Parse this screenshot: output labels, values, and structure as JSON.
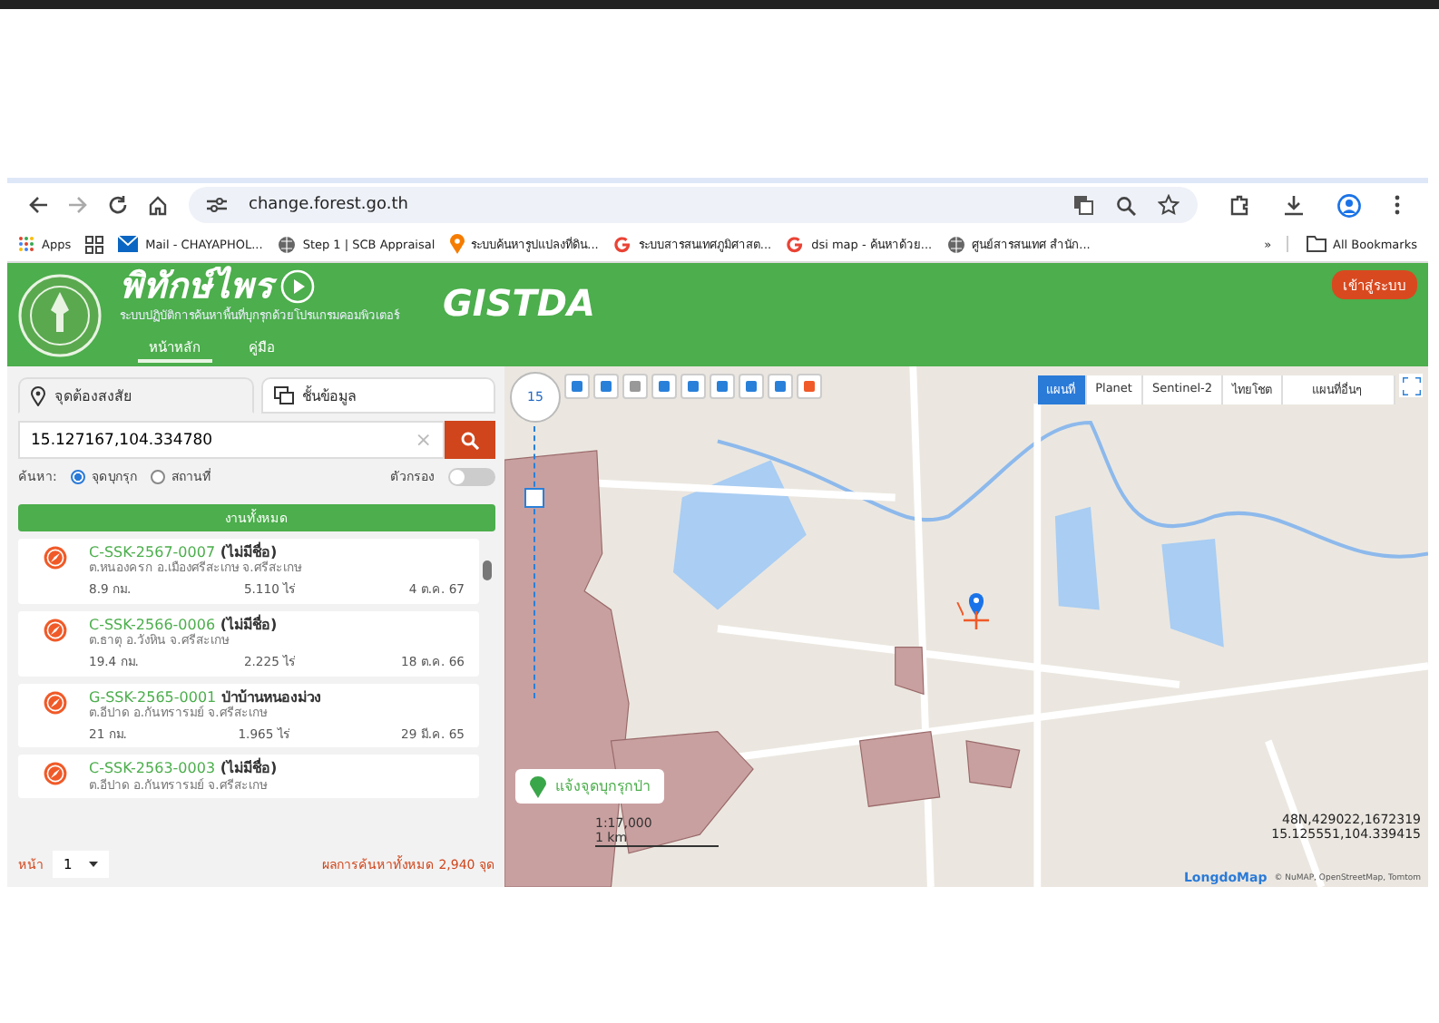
{
  "browser": {
    "url": "change.forest.go.th",
    "bookmarks": [
      {
        "label": "Apps",
        "kind": "apps"
      },
      {
        "kind": "grid"
      },
      {
        "label": "Mail - CHAYAPHOL...",
        "kind": "mail"
      },
      {
        "label": "Step 1 | SCB Appraisal",
        "kind": "globe"
      },
      {
        "label": "ระบบค้นหารูปแปลงที่ดิน...",
        "kind": "pin"
      },
      {
        "label": "ระบบสารสนเทศภูมิศาสต...",
        "kind": "google"
      },
      {
        "label": "dsi map - ค้นหาด้วย...",
        "kind": "google"
      },
      {
        "label": "ศูนย์สารสนเทศ สำนัก...",
        "kind": "globe"
      }
    ],
    "more": "»",
    "all_bookmarks": "All Bookmarks"
  },
  "header": {
    "title": "พิทักษ์ไพร",
    "subtitle": "ระบบปฏิบัติการค้นหาพื้นที่บุกรุกด้วยโปรแกรมคอมพิวเตอร์",
    "partner": "GISTDA",
    "nav": [
      {
        "label": "หน้าหลัก",
        "selected": true
      },
      {
        "label": "คู่มือ",
        "selected": false
      }
    ],
    "login": "เข้าสู่ระบบ"
  },
  "panel": {
    "tabs": [
      {
        "label": "จุดต้องสงสัย",
        "selected": true,
        "kind": "pin"
      },
      {
        "label": "ชั้นข้อมูล",
        "selected": false,
        "kind": "layers"
      }
    ],
    "search": {
      "value": "15.127167,104.334780",
      "clear": "×"
    },
    "search_by": {
      "label": "ค้นหา:",
      "options": [
        {
          "label": "จุดบุกรุก",
          "selected": true
        },
        {
          "label": "สถานที่",
          "selected": false
        }
      ]
    },
    "filter": {
      "label": "ตัวกรอง",
      "on": false
    },
    "all_button": "งานทั้งหมด",
    "results": [
      {
        "code": "C-SSK-2567-0007",
        "name": "(ไม่มีชื่อ)",
        "location": "ต.หนองครก อ.เมืองศรีสะเกษ จ.ศรีสะเกษ",
        "distance": "8.9 กม.",
        "area": "5.110 ไร่",
        "date": "4 ต.ค. 67"
      },
      {
        "code": "C-SSK-2566-0006",
        "name": "(ไม่มีชื่อ)",
        "location": "ต.ธาตุ อ.วังหิน จ.ศรีสะเกษ",
        "distance": "19.4 กม.",
        "area": "2.225 ไร่",
        "date": "18 ต.ค. 66"
      },
      {
        "code": "G-SSK-2565-0001",
        "name": "ป่าบ้านหนองม่วง",
        "location": "ต.อีปาด อ.กันทรารมย์ จ.ศรีสะเกษ",
        "distance": "21 กม.",
        "area": "1.965 ไร่",
        "date": "29 มี.ค. 65"
      },
      {
        "code": "C-SSK-2563-0003",
        "name": "(ไม่มีชื่อ)",
        "location": "ต.อีปาด อ.กันทรารมย์ จ.ศรีสะเกษ"
      }
    ],
    "page_label": "หน้า",
    "page": "1",
    "total": "ผลการค้นหาทั้งหมด 2,940 จุด"
  },
  "map": {
    "zoom": "15",
    "zoom_slider": {
      "level": 0.75
    },
    "layers": [
      {
        "label": "แผนที่",
        "selected": true
      },
      {
        "label": "Planet",
        "selected": false
      },
      {
        "label": "Sentinel-2",
        "selected": false
      },
      {
        "label": "ไทยโชต",
        "selected": false
      },
      {
        "label": "แผนที่อื่นๆ",
        "selected": false
      }
    ],
    "report_button": "แจ้งจุดบุกรุกป่า",
    "scale": "1:17,000",
    "scale_bar": "1 km",
    "utm": "48N,429022,1672319",
    "latlon": "15.125551,104.339415",
    "logo": "LongdoMap",
    "attribution": "© NuMAP, OpenStreetMap, Tomtom"
  }
}
